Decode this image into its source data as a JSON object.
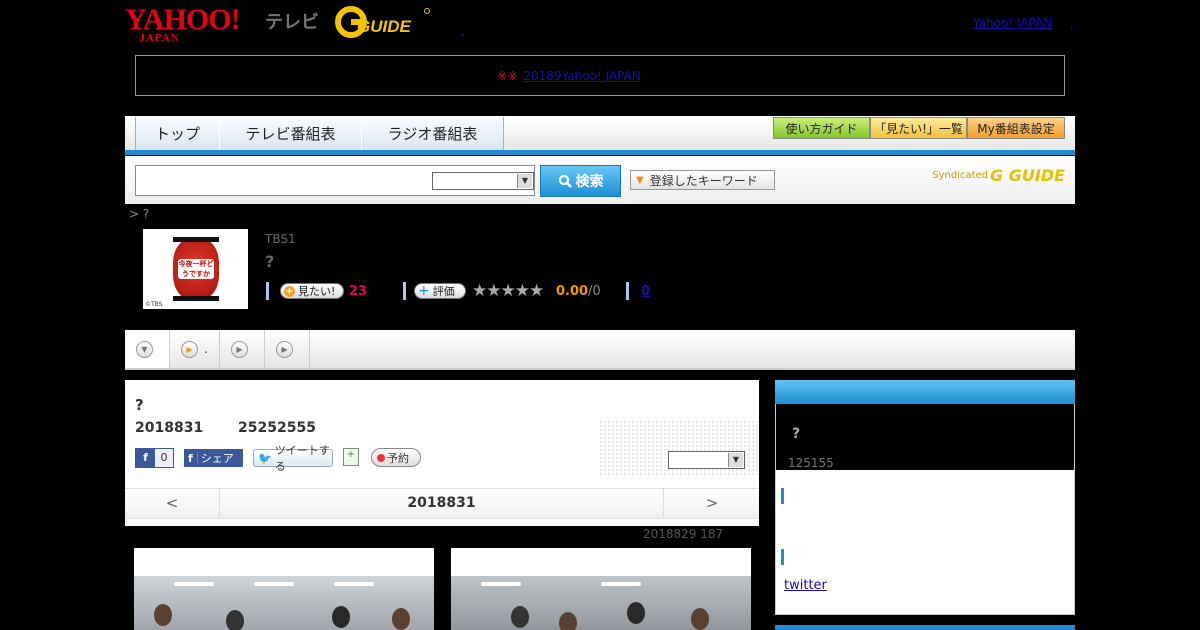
{
  "header": {
    "logo_yahoo": "YAHOO!",
    "logo_japan": "JAPAN",
    "logo_tv": "テレビ",
    "logo_gguide": "G GUIDE",
    "dot": ",",
    "yahoo_japan_link": "Yahoo! JAPAN",
    "trailing_dot": ","
  },
  "notice": {
    "mark": "※※",
    "link_text": "20189Yahoo! JAPAN"
  },
  "nav": {
    "tabs": [
      {
        "label": "トップ"
      },
      {
        "label": "テレビ番組表"
      },
      {
        "label": "ラジオ番組表"
      }
    ],
    "guide_button": "使い方ガイド",
    "want_list_button": "「見たい!」一覧",
    "my_schedule_button": "My番組表設定"
  },
  "search": {
    "input_value": "",
    "select_value": "",
    "button_label": "検索",
    "keywords_button": "登録したキーワード",
    "syndicated": "Syndicated",
    "syndicated_logo": "G GUIDE"
  },
  "breadcrumb": "> ?",
  "program": {
    "thumb_text": "今夜一杯どうですか",
    "thumb_copyright": "©TBS",
    "channel": "TBS1",
    "title": "?",
    "want_label": "見たい!",
    "want_count": "23",
    "rate_label": "評価",
    "stars": "★★★★★",
    "score": "0.00",
    "score_total": "/0",
    "review_count": "0"
  },
  "subnav": {
    "items": [
      {
        "label": ""
      },
      {
        "label": "."
      },
      {
        "label": ""
      },
      {
        "label": ""
      }
    ]
  },
  "detail": {
    "title": "?",
    "date": "2018831",
    "time": "25252555",
    "fb_like_count": "0",
    "fb_f": "f",
    "fb_share_label": "シェア",
    "tweet_label": "ツイートする",
    "reserve_label": "予約",
    "select_value": "",
    "prev_arrow": "<",
    "current_date": "2018831",
    "next_arrow": ">",
    "updated": "2018829  187"
  },
  "sidebar": {
    "question": "?",
    "numbers": "125155",
    "twitter_link": "twitter"
  },
  "colors": {
    "accent_blue": "#1d8fd0",
    "yahoo_red": "#e60012",
    "score_orange": "#f39800",
    "want_pink": "#e60060"
  }
}
